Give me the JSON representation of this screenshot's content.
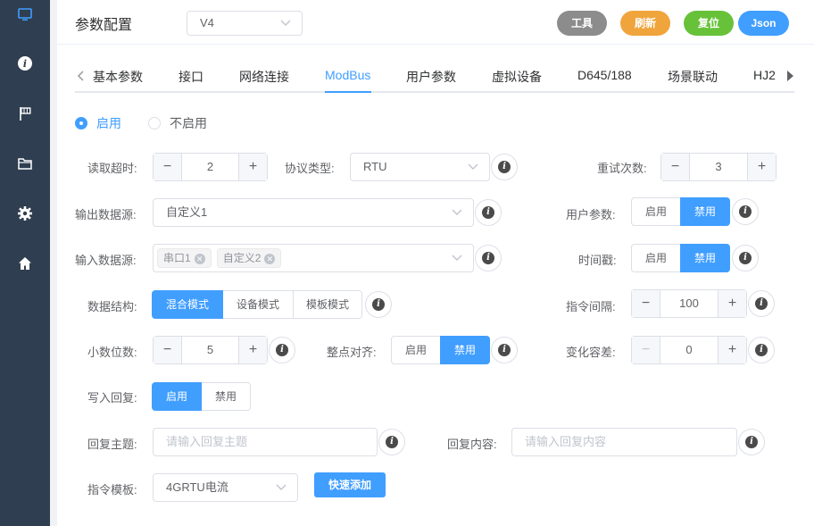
{
  "header": {
    "title": "参数配置",
    "version": "V4",
    "buttons": {
      "tool": "工具",
      "refresh": "刷新",
      "reset": "复位",
      "json": "Json"
    }
  },
  "colors": {
    "sidebar": "#2f3e50",
    "accent": "#409eff",
    "tool_btn": "#8c8c8c",
    "refresh_btn": "#f0a53c",
    "reset_btn": "#67c23a",
    "json_btn": "#409eff"
  },
  "sidebar": {
    "icons": [
      "monitor-icon",
      "info-icon",
      "flag-icon",
      "folder-icon",
      "gear-icon",
      "home-icon"
    ]
  },
  "tabs": [
    "基本参数",
    "接口",
    "网络连接",
    "ModBus",
    "用户参数",
    "虚拟设备",
    "D645/188",
    "场景联动",
    "HJ2"
  ],
  "active_tab": "ModBus",
  "enable": {
    "on_label": "启用",
    "off_label": "不启用",
    "selected": "启用"
  },
  "form": {
    "read_timeout": {
      "label": "读取超时:",
      "value": "2"
    },
    "protocol": {
      "label": "协议类型:",
      "value": "RTU"
    },
    "retries": {
      "label": "重试次数:",
      "value": "3"
    },
    "output_source": {
      "label": "输出数据源:",
      "value": "自定义1"
    },
    "user_params": {
      "label": "用户参数:",
      "options": [
        "启用",
        "禁用"
      ],
      "selected": "禁用"
    },
    "input_source": {
      "label": "输入数据源:",
      "tags": [
        "串口1",
        "自定义2"
      ]
    },
    "timestamp": {
      "label": "时间戳:",
      "options": [
        "启用",
        "禁用"
      ],
      "selected": "禁用"
    },
    "data_structure": {
      "label": "数据结构:",
      "options": [
        "混合模式",
        "设备模式",
        "模板模式"
      ],
      "selected": "混合模式"
    },
    "cmd_interval": {
      "label": "指令间隔:",
      "value": "100"
    },
    "decimals": {
      "label": "小数位数:",
      "value": "5"
    },
    "align": {
      "label": "整点对齐:",
      "options": [
        "启用",
        "禁用"
      ],
      "selected": "禁用"
    },
    "tolerance": {
      "label": "变化容差:",
      "value": "0"
    },
    "write_reply": {
      "label": "写入回复:",
      "options": [
        "启用",
        "禁用"
      ],
      "selected": "启用"
    },
    "reply_topic": {
      "label": "回复主题:",
      "placeholder": "请输入回复主题"
    },
    "reply_content": {
      "label": "回复内容:",
      "placeholder": "请输入回复内容"
    },
    "cmd_template": {
      "label": "指令模板:",
      "value": "4GRTU电流"
    },
    "quick_add": "快速添加"
  }
}
